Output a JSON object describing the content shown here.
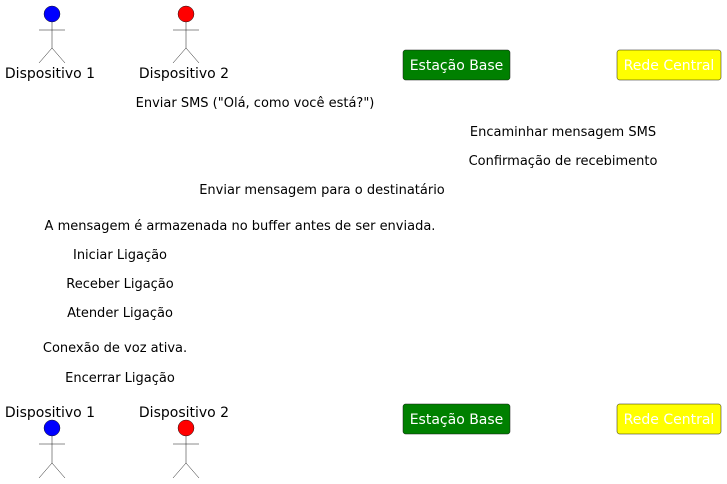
{
  "participants": [
    {
      "id": "d1",
      "label": "Dispositivo 1",
      "kind": "actor",
      "color": "#0000FF"
    },
    {
      "id": "d2",
      "label": "Dispositivo 2",
      "kind": "actor",
      "color": "#FF0000"
    },
    {
      "id": "eb",
      "label": "Estação Base",
      "kind": "box",
      "color": "#008000",
      "text_color": "#FFFFFF"
    },
    {
      "id": "rc",
      "label": "Rede Central",
      "kind": "box",
      "color": "#FFFF00",
      "text_color": "#FFFFFF"
    }
  ],
  "messages": [
    {
      "text": "Enviar SMS (\"Olá, como você está?\")"
    },
    {
      "text": "Encaminhar mensagem SMS"
    },
    {
      "text": "Confirmação de recebimento"
    },
    {
      "text": "Enviar mensagem para o destinatário"
    },
    {
      "text": "A mensagem é armazenada no buffer antes de ser enviada."
    },
    {
      "text": "Iniciar Ligação"
    },
    {
      "text": "Receber Ligação"
    },
    {
      "text": "Atender Ligação"
    },
    {
      "text": "Conexão de voz ativa."
    },
    {
      "text": "Encerrar Ligação"
    }
  ]
}
